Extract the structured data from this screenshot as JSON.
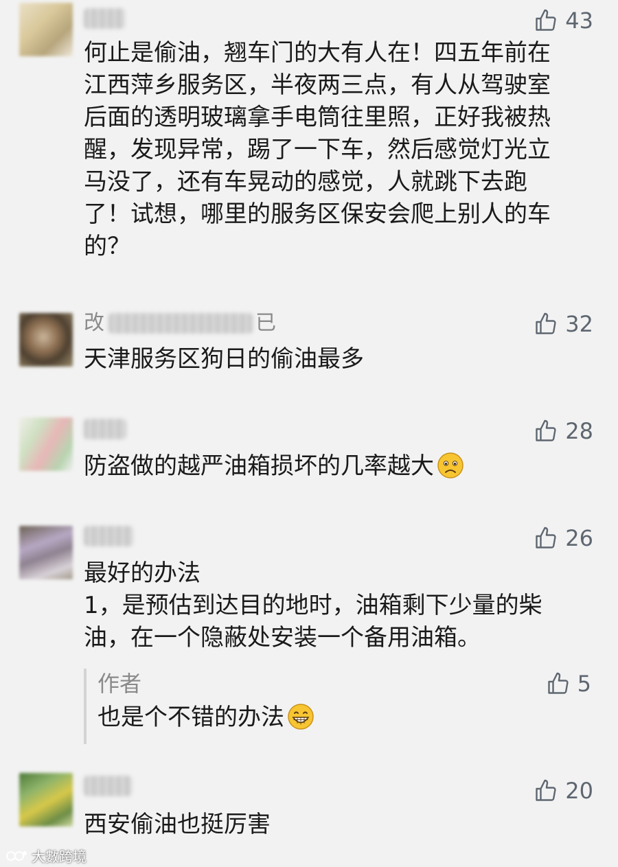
{
  "comments": [
    {
      "name": "",
      "likes": "43",
      "lines": [
        "何止是偷油，翘车门的大有人在！四五年前在",
        "江西萍乡服务区，半夜两三点，有人从驾驶室",
        "后面的透明玻璃拿手电筒往里照，正好我被热",
        "醒，发现异常，踢了一下车，然后感觉灯光立",
        "马没了，还有车晃动的感觉，人就跳下去跑",
        "了！试想，哪里的服务区保安会爬上别人的车",
        "的？"
      ]
    },
    {
      "name": "改",
      "name_tail": "已",
      "likes": "32",
      "lines": [
        "天津服务区狗日的偷油最多"
      ]
    },
    {
      "name": "",
      "likes": "28",
      "lines": [
        "防盗做的越严油箱损坏的几率越大"
      ],
      "emoji": "sad-face-emoji"
    },
    {
      "name": "",
      "likes": "26",
      "lines": [
        "最好的办法",
        "1，是预估到达目的地时，油箱剩下少量的柴",
        "油，在一个隐蔽处安装一个备用油箱。"
      ],
      "reply": {
        "name": "作者",
        "likes": "5",
        "text": "也是个不错的办法",
        "emoji": "grin-face-emoji"
      }
    },
    {
      "name": "",
      "likes": "20",
      "lines": [
        "西安偷油也挺厉害"
      ]
    }
  ],
  "watermark": "大數跨境",
  "colors": {
    "background": "#f2f2f2",
    "text": "#1a1a1a",
    "meta": "#8a8a8a",
    "like_icon": "#5e6670",
    "emoji_yellow": "#f7c531"
  },
  "icons": {
    "like": "thumbs-up-icon"
  }
}
